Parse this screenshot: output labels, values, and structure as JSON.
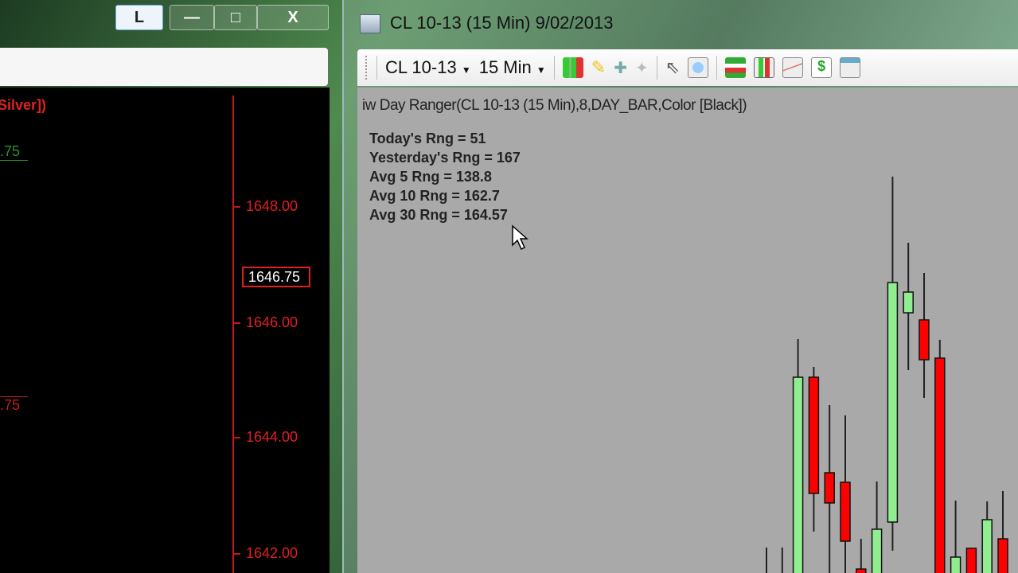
{
  "left_window": {
    "buttons": {
      "l": "L",
      "minimize": "—",
      "maximize": "□",
      "close": "X"
    },
    "indicator_fragment": "Silver])",
    "level_green": ".75",
    "level_red": ".75",
    "price_labels": [
      "1648.00",
      "1646.00",
      "1644.00",
      "1642.00"
    ],
    "current_price": "1646.75",
    "colors": {
      "axis": "#c01818",
      "green": "#2f8f2f"
    }
  },
  "right_window": {
    "title": "CL 10-13 (15 Min)  9/02/2013",
    "toolbar": {
      "symbol": "CL 10-13",
      "interval": "15 Min"
    },
    "indicator_label": "iw Day Ranger(CL 10-13 (15 Min),8,DAY_BAR,Color [Black])",
    "stats": [
      "Today's Rng = 51",
      "Yesterday's Rng = 167",
      "Avg 5 Rng = 138.8",
      "Avg 10 Rng = 162.7",
      "Avg 30 Rng = 164.57"
    ]
  },
  "chart_data": {
    "type": "candlestick",
    "note_units": "relative price units",
    "ylim": [
      0,
      61
    ],
    "colors": {
      "up": "#90ee90",
      "down": "#ff0000"
    },
    "candles": [
      {
        "o": null,
        "h": 3.2,
        "l": 0,
        "c": null
      },
      {
        "o": null,
        "h": 3.2,
        "l": 0,
        "c": null
      },
      {
        "o": 0,
        "h": 29.4,
        "l": 0,
        "c": 24.6
      },
      {
        "o": 24.6,
        "h": 25.9,
        "l": 5.4,
        "c": 10.2
      },
      {
        "o": 12.6,
        "h": 21.1,
        "l": 0,
        "c": 9.0
      },
      {
        "o": 11.4,
        "h": 19.8,
        "l": 0,
        "c": 4.2
      },
      {
        "o": 0.5,
        "h": 4.3,
        "l": 0,
        "c": 0
      },
      {
        "o": 0,
        "h": 11.5,
        "l": 0,
        "c": 5.5
      },
      {
        "o": 6.6,
        "h": 49.8,
        "l": 3.0,
        "c": 36.5
      },
      {
        "o": 32.9,
        "h": 41.5,
        "l": 25.7,
        "c": 35.3
      },
      {
        "o": 31.8,
        "h": 37.7,
        "l": 22.2,
        "c": 27.0
      },
      {
        "o": 27.0,
        "h": 29.3,
        "l": 0,
        "c": 0
      },
      {
        "o": 0,
        "h": 9.1,
        "l": 0,
        "c": 2.0
      },
      {
        "o": 3.1,
        "h": 3.1,
        "l": 0,
        "c": 0
      },
      {
        "o": 0,
        "h": 9.0,
        "l": 0,
        "c": 6.7
      },
      {
        "o": 4.3,
        "h": 10.3,
        "l": 0,
        "c": 0
      }
    ]
  }
}
